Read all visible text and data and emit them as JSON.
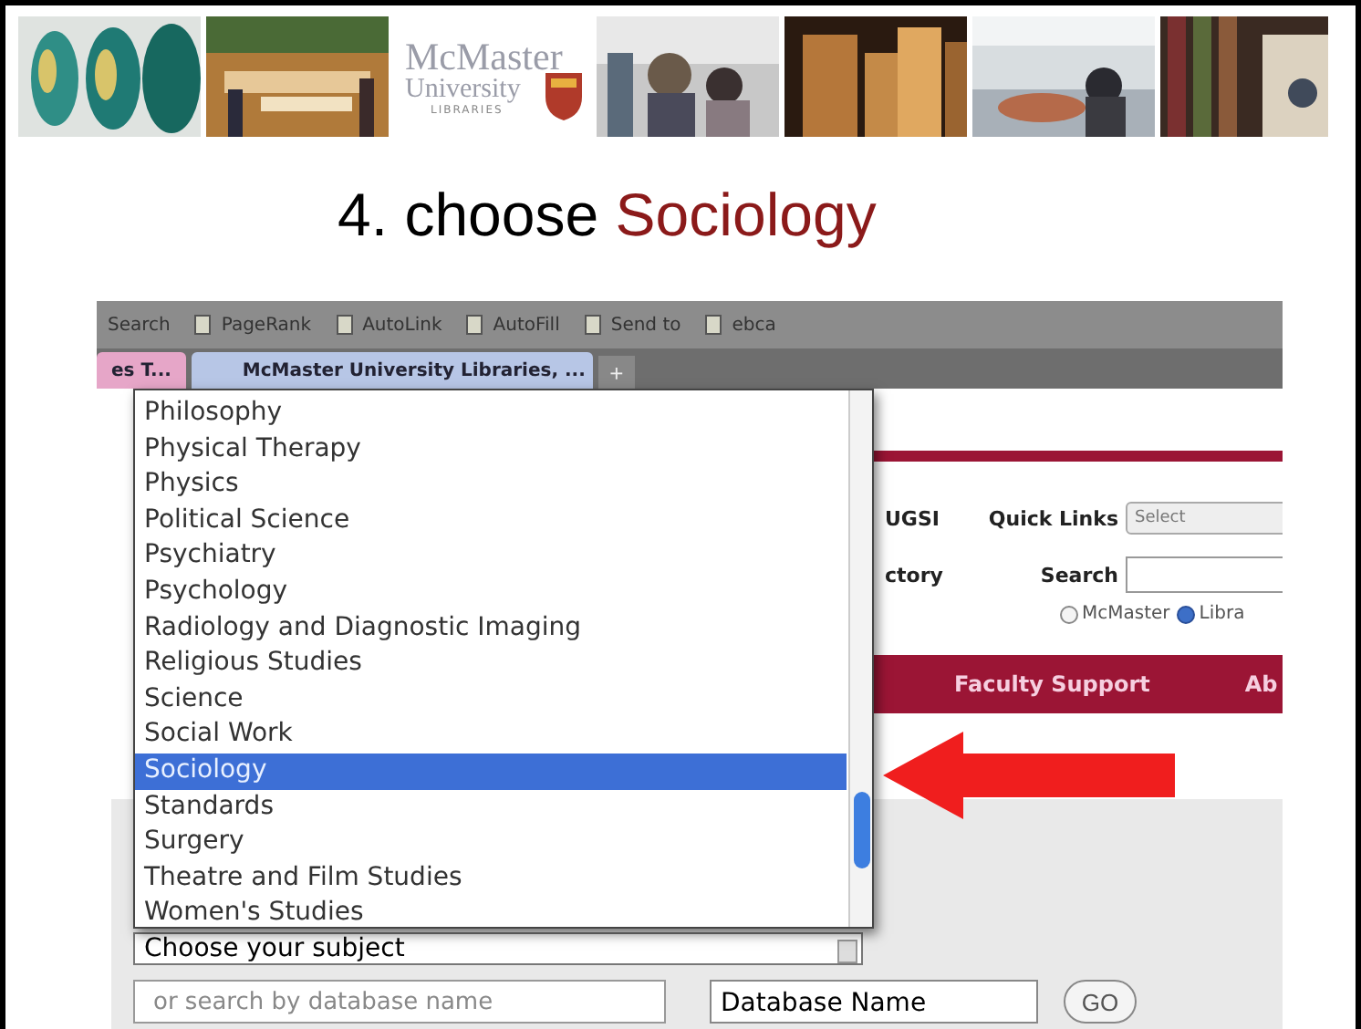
{
  "banner": {
    "logo": {
      "name": "McMaster",
      "sub": "University",
      "unit": "LIBRARIES"
    }
  },
  "slide_title": {
    "prefix": "4. choose",
    "subject": "Sociology"
  },
  "browser": {
    "toolbar": [
      "Search",
      "PageRank",
      "AutoLink",
      "AutoFill",
      "Send to",
      "ebca"
    ],
    "tabs": [
      {
        "label": "es T...",
        "selected": false
      },
      {
        "label": "McMaster University Libraries, ...",
        "selected": true
      }
    ],
    "new_tab": "+"
  },
  "page": {
    "header": [
      {
        "label": "UGSI",
        "field_label": "Quick Links",
        "kind": "select",
        "value": "Select"
      },
      {
        "label": "ctory",
        "field_label": "Search",
        "kind": "input"
      }
    ],
    "scope": [
      {
        "label": "McMaster",
        "selected": false
      },
      {
        "label": "Libra",
        "selected": true
      }
    ],
    "nav": [
      "Faculty Support",
      "Ab"
    ],
    "subject_select": {
      "value": "Choose your subject",
      "expanded": true,
      "options": [
        {
          "label": "Philosophy",
          "selected": false
        },
        {
          "label": "Physical Therapy",
          "selected": false
        },
        {
          "label": "Physics",
          "selected": false
        },
        {
          "label": "Political Science",
          "selected": false
        },
        {
          "label": "Psychiatry",
          "selected": false
        },
        {
          "label": "Psychology",
          "selected": false
        },
        {
          "label": "Radiology and Diagnostic Imaging",
          "selected": false
        },
        {
          "label": "Religious Studies",
          "selected": false
        },
        {
          "label": "Science",
          "selected": false
        },
        {
          "label": "Social Work",
          "selected": false
        },
        {
          "label": "Sociology",
          "selected": true
        },
        {
          "label": "Standards",
          "selected": false
        },
        {
          "label": "Surgery",
          "selected": false
        },
        {
          "label": "Theatre and Film Studies",
          "selected": false
        },
        {
          "label": "Women's Studies",
          "selected": false
        }
      ]
    },
    "db_search": {
      "placeholder": "or search by database name"
    },
    "db_select": {
      "value": "Database Name"
    },
    "go_button": "GO"
  }
}
